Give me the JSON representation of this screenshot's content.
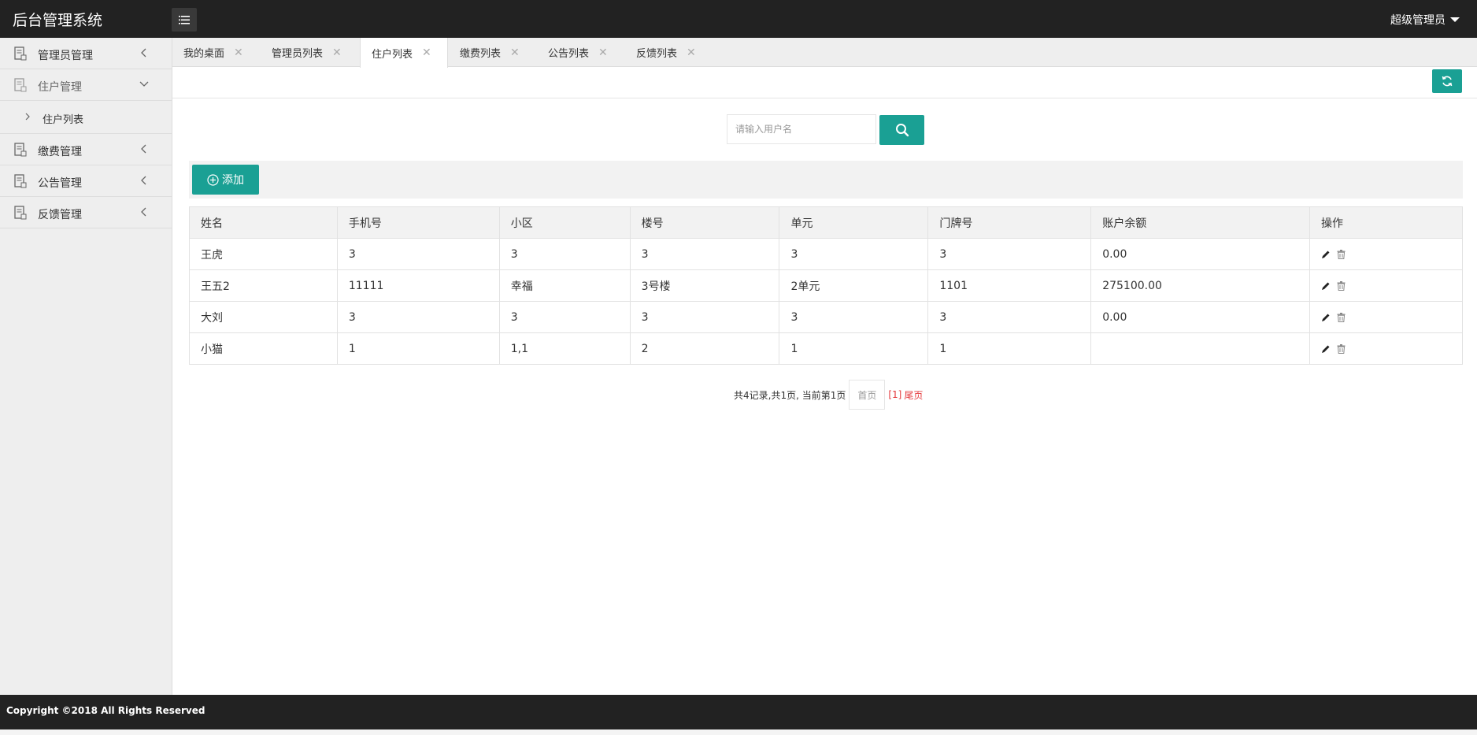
{
  "header": {
    "title": "后台管理系统",
    "user": "超级管理员"
  },
  "sidebar": {
    "items": [
      {
        "label": "管理员管理"
      },
      {
        "label": "住户管理",
        "children": [
          {
            "label": "住户列表"
          }
        ]
      },
      {
        "label": "缴费管理"
      },
      {
        "label": "公告管理"
      },
      {
        "label": "反馈管理"
      }
    ]
  },
  "tabs": [
    {
      "label": "我的桌面"
    },
    {
      "label": "管理员列表"
    },
    {
      "label": "住户列表",
      "active": true
    },
    {
      "label": "缴费列表"
    },
    {
      "label": "公告列表"
    },
    {
      "label": "反馈列表"
    }
  ],
  "search": {
    "placeholder": "请输入用户名",
    "value": ""
  },
  "toolbar": {
    "add_label": "添加"
  },
  "table": {
    "columns": [
      "姓名",
      "手机号",
      "小区",
      "楼号",
      "单元",
      "门牌号",
      "账户余额",
      "操作"
    ],
    "rows": [
      [
        "王虎",
        "3",
        "3",
        "3",
        "3",
        "3",
        "0.00"
      ],
      [
        "王五2",
        "11111",
        "幸福",
        "3号楼",
        "2单元",
        "1101",
        "275100.00"
      ],
      [
        "大刘",
        "3",
        "3",
        "3",
        "3",
        "3",
        "0.00"
      ],
      [
        "小猫",
        "1",
        "1,1",
        "2",
        "1",
        "1",
        ""
      ]
    ]
  },
  "pagination": {
    "summary": "共4记录,共1页, 当前第1页",
    "first": "首页",
    "current": "[1]",
    "last": "尾页"
  },
  "footer": {
    "copyright": "Copyright ©2018 All Rights Reserved"
  },
  "colors": {
    "accent": "#1aa094",
    "header_bg": "#222222",
    "link_red": "#e4393c"
  },
  "icons": {
    "nav": "document-icon",
    "menu": "list-icon",
    "refresh": "refresh-icon",
    "search": "search-icon",
    "add": "plus-circle-icon",
    "edit": "pencil-icon",
    "delete": "trash-icon"
  }
}
